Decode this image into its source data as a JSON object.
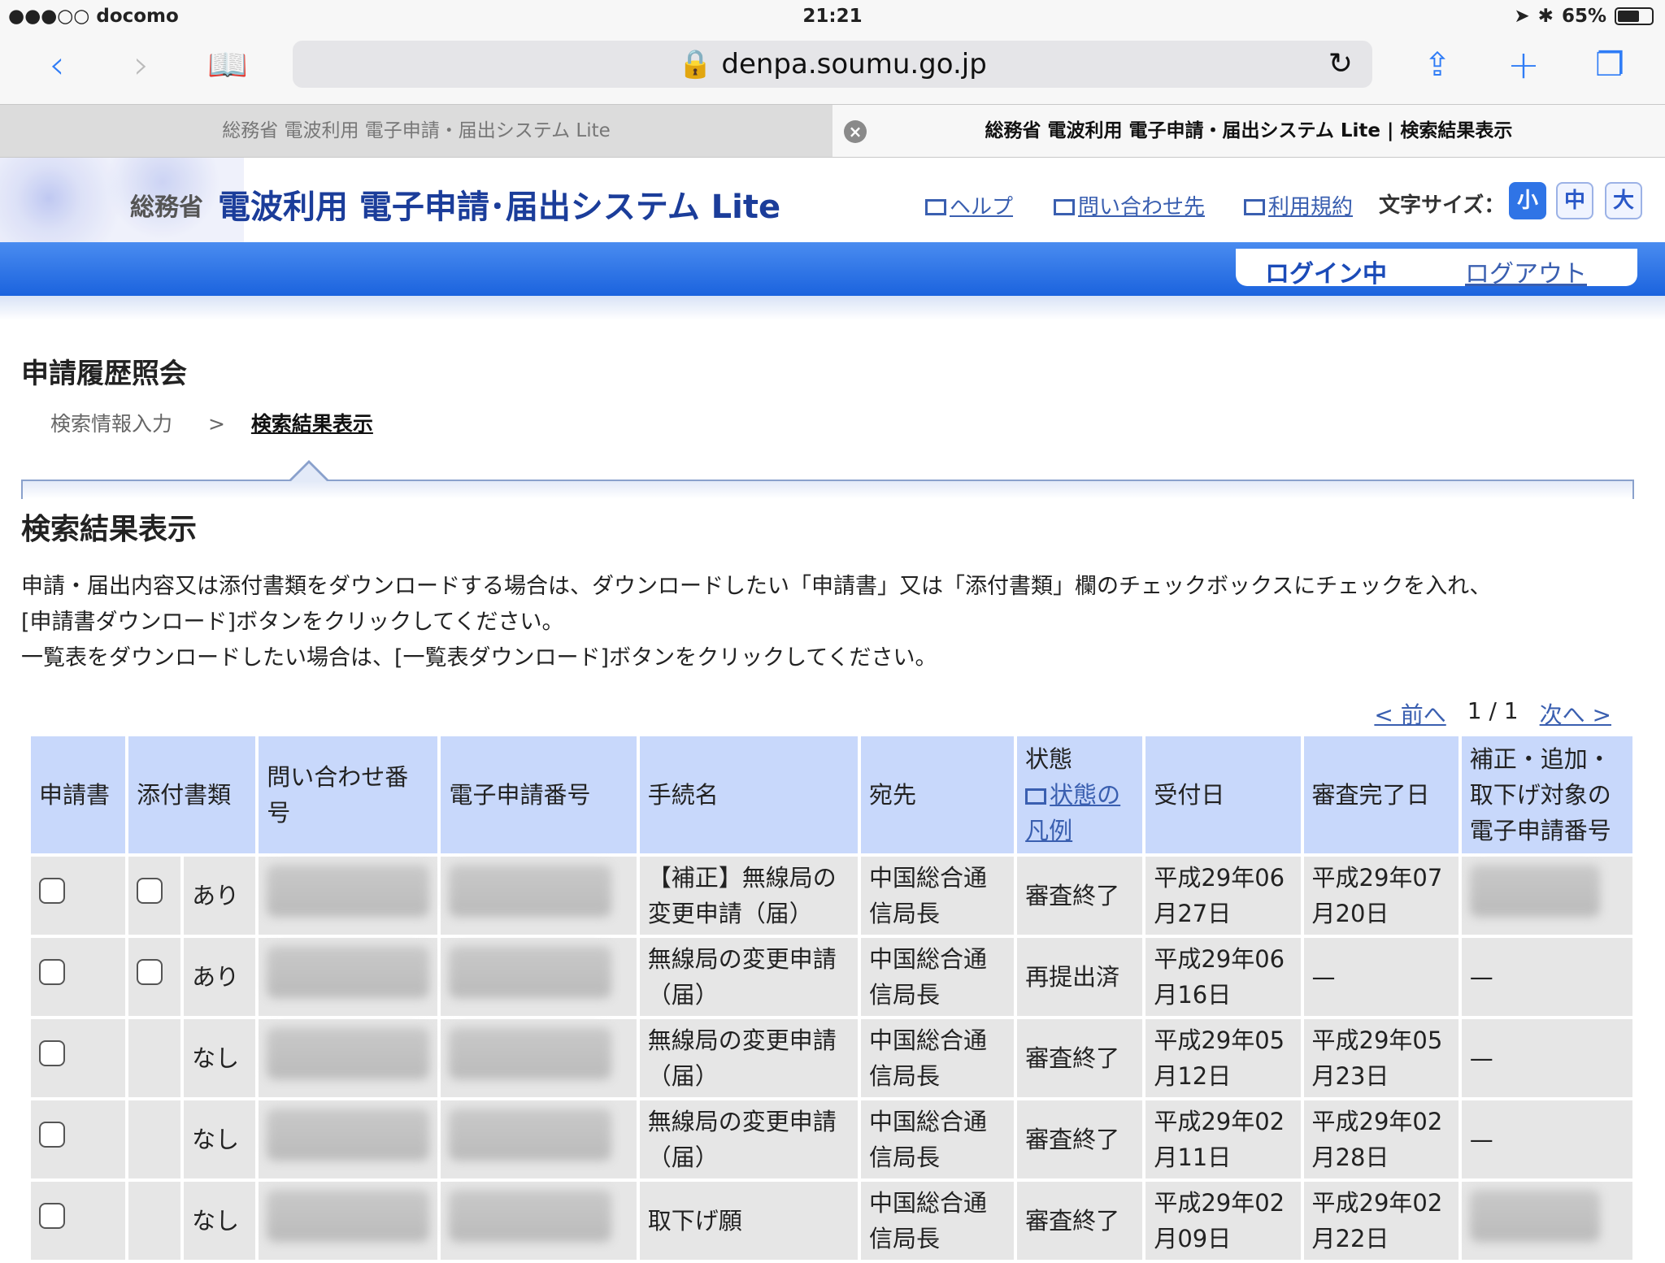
{
  "status_bar": {
    "carrier": "●●●○○ docomo",
    "time": "21:21",
    "battery": "65%",
    "battery_fraction": 0.65
  },
  "browser": {
    "url": "denpa.soumu.go.jp",
    "tabs": [
      {
        "title": "総務省 電波利用 電子申請・届出システム Lite",
        "active": false
      },
      {
        "title": "総務省 電波利用 電子申請・届出システム Lite | 検索結果表示",
        "active": true
      }
    ]
  },
  "header": {
    "ministry": "総務省",
    "title": "電波利用 電子申請･届出システム Lite",
    "links": [
      "ヘルプ",
      "問い合わせ先",
      "利用規約"
    ],
    "font_size_label": "文字サイズ：",
    "font_sizes": [
      "小",
      "中",
      "大"
    ],
    "selected_font_size": "小"
  },
  "session": {
    "state": "ログイン中",
    "logout": "ログアウト"
  },
  "page": {
    "heading": "申請履歴照会",
    "breadcrumb": {
      "step1": "検索情報入力",
      "separator": ">",
      "current": "検索結果表示"
    },
    "subheading": "検索結果表示",
    "instructions": [
      "申請・届出内容又は添付書類をダウンロードする場合は、ダウンロードしたい「申請書」又は「添付書類」欄のチェックボックスにチェックを入れ、",
      "[申請書ダウンロード]ボタンをクリックしてください。",
      "一覧表をダウンロードしたい場合は、[一覧表ダウンロード]ボタンをクリックしてください。"
    ]
  },
  "pager": {
    "prev": "< 前へ",
    "current": "1 / 1",
    "next": "次へ >"
  },
  "table": {
    "headers": {
      "application": "申請書",
      "attachment": "添付書類",
      "inquiry_no": "問い合わせ番号",
      "e_app_no": "電子申請番号",
      "procedure": "手続名",
      "destination": "宛先",
      "status": "状態",
      "status_legend": "状態の凡例",
      "received": "受付日",
      "completed": "審査完了日",
      "related": "補正・追加・取下げ対象の電子申請番号"
    },
    "rows": [
      {
        "attachment": "あり",
        "has_checkbox": true,
        "procedure": "【補正】無線局の変更申請（届）",
        "destination": "中国総合通信局長",
        "status": "審査終了",
        "received": "平成29年06月27日",
        "completed": "平成29年07月20日",
        "related": ""
      },
      {
        "attachment": "あり",
        "has_checkbox": true,
        "procedure": "無線局の変更申請（届）",
        "destination": "中国総合通信局長",
        "status": "再提出済",
        "received": "平成29年06月16日",
        "completed": "—",
        "related": "—"
      },
      {
        "attachment": "なし",
        "has_checkbox": false,
        "procedure": "無線局の変更申請（届）",
        "destination": "中国総合通信局長",
        "status": "審査終了",
        "received": "平成29年05月12日",
        "completed": "平成29年05月23日",
        "related": "—"
      },
      {
        "attachment": "なし",
        "has_checkbox": false,
        "procedure": "無線局の変更申請（届）",
        "destination": "中国総合通信局長",
        "status": "審査終了",
        "received": "平成29年02月11日",
        "completed": "平成29年02月28日",
        "related": "—"
      },
      {
        "attachment": "なし",
        "has_checkbox": false,
        "procedure": "取下げ願",
        "destination": "中国総合通信局長",
        "status": "審査終了",
        "received": "平成29年02月09日",
        "completed": "平成29年02月22日",
        "related": ""
      }
    ]
  }
}
